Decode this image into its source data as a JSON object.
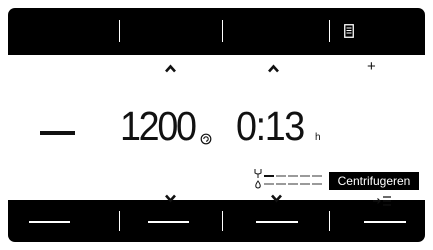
{
  "program": {
    "spin_speed": "1200",
    "spin_icon": "spin-symbol-icon",
    "time": "0:13",
    "time_unit": "h",
    "status": "Centrifugeren",
    "drain_icon": "pump-drain-icon",
    "progress_segments_filled": 1,
    "progress_segments_total": 5
  },
  "controls": {
    "plus_label": "+",
    "up_icon": "chevron-up-icon",
    "down_icon": "chevron-down-icon",
    "minus_icon": "minus-icon",
    "menu_icon": "menu-list-icon",
    "doc_icon": "document-icon"
  },
  "colors": {
    "screen": "#000000",
    "panel": "#ffffff",
    "text": "#111111",
    "progress_inactive": "#9a9a9a"
  }
}
